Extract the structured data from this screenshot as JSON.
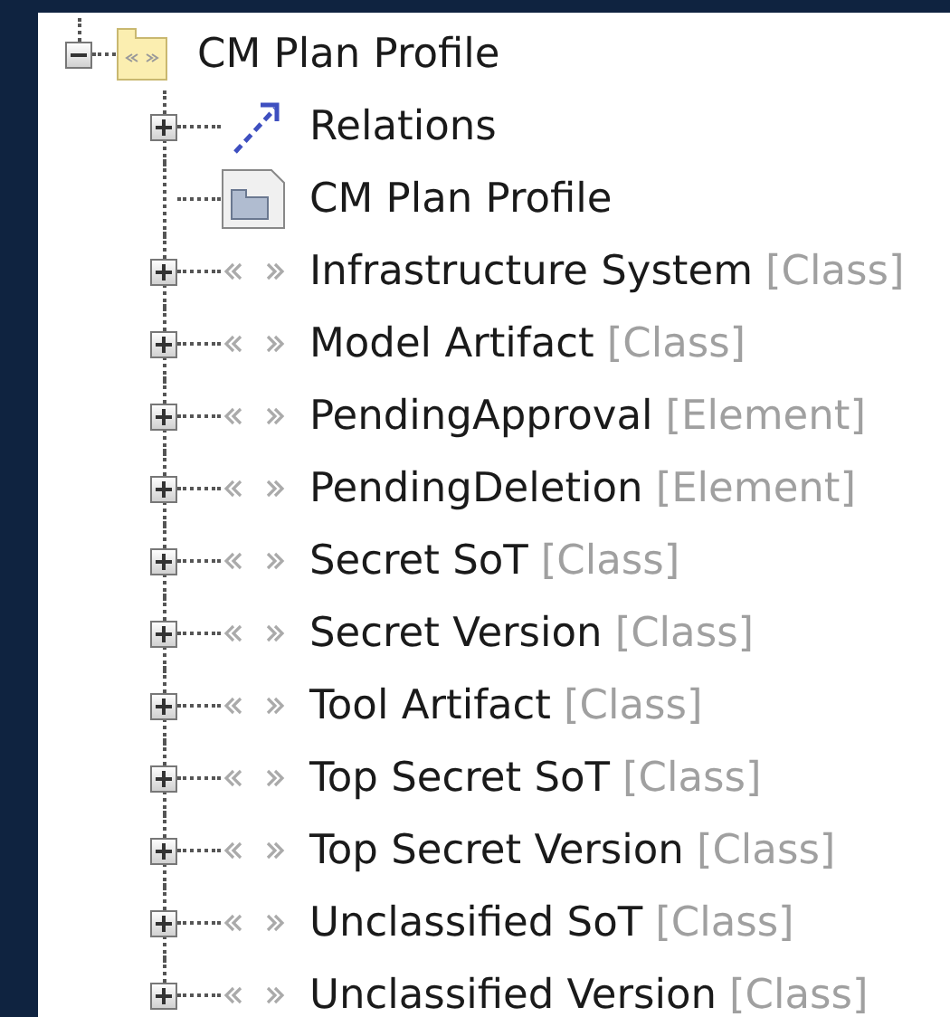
{
  "tree": {
    "label": "CM Plan Profile",
    "kind": "package",
    "expanded": true,
    "children": [
      {
        "label": "Relations",
        "kind": "relations",
        "expanded": false
      },
      {
        "label": "CM Plan Profile",
        "kind": "diagram"
      },
      {
        "label": "Infrastructure System",
        "type": "[Class]",
        "kind": "stereotype",
        "expanded": false
      },
      {
        "label": "Model Artifact",
        "type": "[Class]",
        "kind": "stereotype",
        "expanded": false
      },
      {
        "label": "PendingApproval",
        "type": "[Element]",
        "kind": "stereotype",
        "expanded": false
      },
      {
        "label": "PendingDeletion",
        "type": "[Element]",
        "kind": "stereotype",
        "expanded": false
      },
      {
        "label": "Secret SoT",
        "type": "[Class]",
        "kind": "stereotype",
        "expanded": false
      },
      {
        "label": "Secret Version",
        "type": "[Class]",
        "kind": "stereotype",
        "expanded": false
      },
      {
        "label": "Tool Artifact",
        "type": "[Class]",
        "kind": "stereotype",
        "expanded": false
      },
      {
        "label": "Top Secret SoT",
        "type": "[Class]",
        "kind": "stereotype",
        "expanded": false
      },
      {
        "label": "Top Secret Version",
        "type": "[Class]",
        "kind": "stereotype",
        "expanded": false
      },
      {
        "label": "Unclassified SoT",
        "type": "[Class]",
        "kind": "stereotype",
        "expanded": false
      },
      {
        "label": "Unclassified Version",
        "type": "[Class]",
        "kind": "stereotype",
        "expanded": false
      }
    ]
  }
}
